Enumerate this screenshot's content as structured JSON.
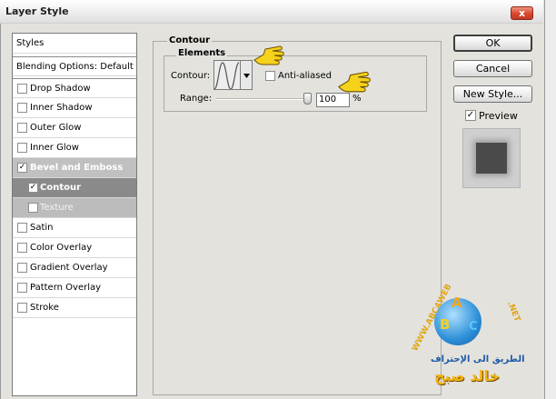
{
  "window": {
    "title": "Layer Style",
    "close_glyph": "x"
  },
  "styles_panel": {
    "items": [
      {
        "label": "Styles"
      },
      {
        "label": "Blending Options: Default"
      },
      {
        "label": "Drop Shadow",
        "checked": false
      },
      {
        "label": "Inner Shadow",
        "checked": false
      },
      {
        "label": "Outer Glow",
        "checked": false
      },
      {
        "label": "Inner Glow",
        "checked": false
      },
      {
        "label": "Bevel and Emboss",
        "checked": true,
        "check_glyph": "✓"
      },
      {
        "label": "Contour",
        "checked": true,
        "check_glyph": "✓"
      },
      {
        "label": "Texture",
        "checked": false
      },
      {
        "label": "Satin",
        "checked": false
      },
      {
        "label": "Color Overlay",
        "checked": false
      },
      {
        "label": "Gradient Overlay",
        "checked": false
      },
      {
        "label": "Pattern Overlay",
        "checked": false
      },
      {
        "label": "Stroke",
        "checked": false
      }
    ]
  },
  "contour": {
    "group_title": "Contour",
    "elements_title": "Elements",
    "contour_label": "Contour:",
    "anti_aliased_label": "Anti-aliased",
    "anti_aliased": false,
    "range_label": "Range:",
    "range_value": "100",
    "range_unit": "%",
    "range_percent": 100
  },
  "buttons": {
    "ok": "OK",
    "cancel": "Cancel",
    "new_style": "New Style..."
  },
  "preview": {
    "label": "Preview",
    "checked": true,
    "check_glyph": "✓"
  },
  "watermark": {
    "letter_a": "A",
    "letter_b": "B",
    "letter_c": "C",
    "url_left": "WWW.ABC4WEB",
    "url_right": ".NET",
    "arabic_line1": "الطريق الى الإحتراف",
    "arabic_line2": "خالد صبح"
  },
  "colors": {
    "selected_row": "#8a8a8a",
    "semi_selected_row": "#c0c0c0",
    "close_button": "#d9462e",
    "hand_pointer": "#f5d21b"
  },
  "icons": {
    "close": "close-icon",
    "contour_dropdown": "chevron-down-icon",
    "hand_pointer": "hand-pointer-icon"
  }
}
